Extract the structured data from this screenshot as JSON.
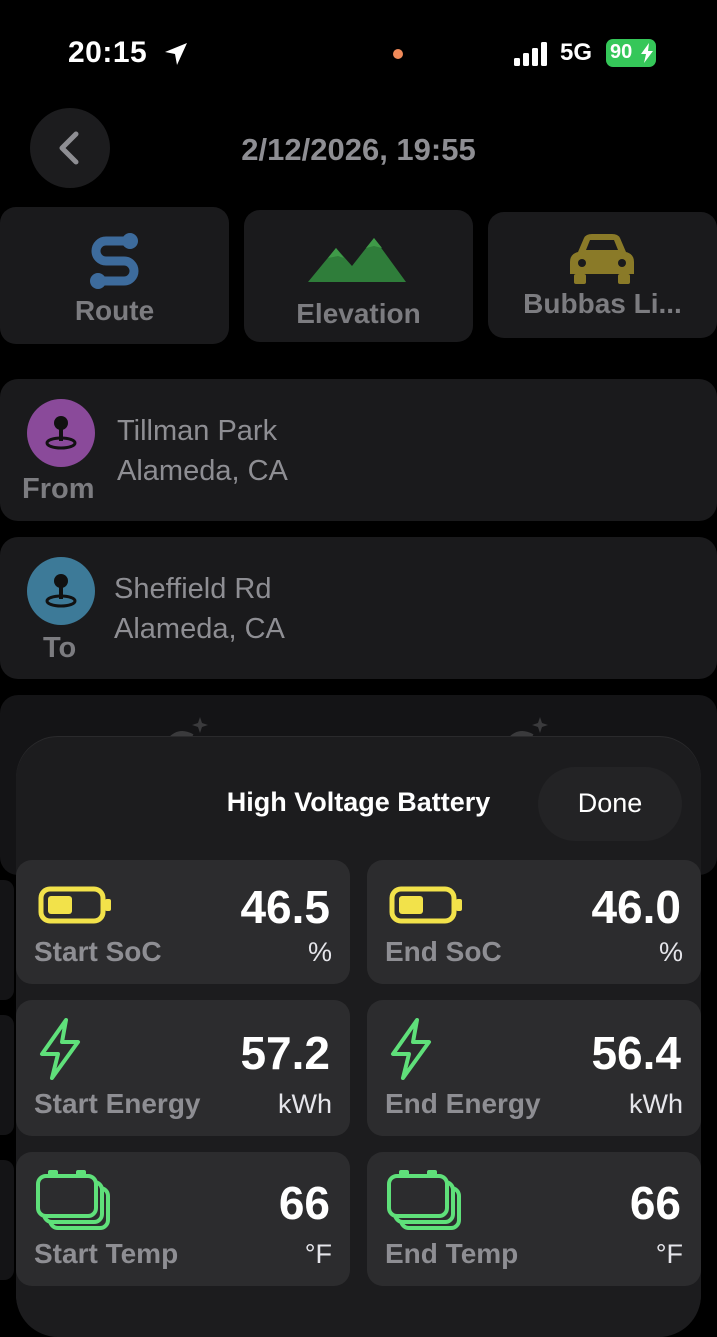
{
  "status": {
    "time": "20:15",
    "network": "5G",
    "battery": "90"
  },
  "header": {
    "title": "2/12/2026, 19:55"
  },
  "tiles": [
    {
      "label": "Route",
      "icon": "route-icon",
      "color": "#3d6b9c"
    },
    {
      "label": "Elevation",
      "icon": "mountain-icon",
      "color": "#2f7d3a"
    },
    {
      "label": "Bubbas Li...",
      "icon": "car-icon",
      "color": "#8a7a28"
    }
  ],
  "from": {
    "role": "From",
    "line1": "Tillman Park",
    "line2": "Alameda, CA",
    "color": "#8a4a9a"
  },
  "to": {
    "role": "To",
    "line1": "Sheffield Rd",
    "line2": "Alameda, CA",
    "color": "#3d7a98"
  },
  "sheet": {
    "title": "High Voltage Battery",
    "done": "Done",
    "cells": [
      {
        "caption": "Start SoC",
        "value": "46.5",
        "unit": "%",
        "icon": "battery-icon"
      },
      {
        "caption": "End SoC",
        "value": "46.0",
        "unit": "%",
        "icon": "battery-icon"
      },
      {
        "caption": "Start Energy",
        "value": "57.2",
        "unit": "kWh",
        "icon": "bolt-icon"
      },
      {
        "caption": "End Energy",
        "value": "56.4",
        "unit": "kWh",
        "icon": "bolt-icon"
      },
      {
        "caption": "Start Temp",
        "value": "66",
        "unit": "°F",
        "icon": "battery-stack-icon"
      },
      {
        "caption": "End Temp",
        "value": "66",
        "unit": "°F",
        "icon": "battery-stack-icon"
      }
    ]
  },
  "colors": {
    "battery_yellow": "#f2e24a",
    "energy_green": "#5fe07a"
  }
}
